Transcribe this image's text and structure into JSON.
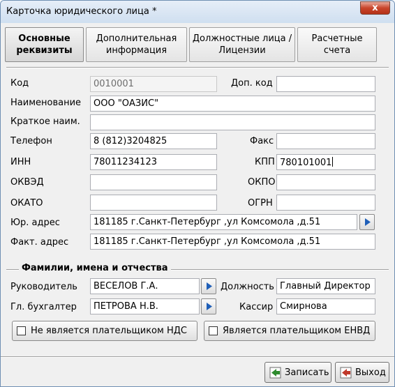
{
  "window": {
    "title": "Карточка юридического лица *",
    "close_glyph": "x"
  },
  "tabs": [
    {
      "label": "Основные\nреквизиты",
      "active": true
    },
    {
      "label": "Дополнительная\nинформация",
      "active": false
    },
    {
      "label": "Должностные лица /\nЛицензии",
      "active": false
    },
    {
      "label": "Расчетные\nсчета",
      "active": false
    }
  ],
  "fields": {
    "kod": {
      "label": "Код",
      "value": "0010001"
    },
    "dop_kod": {
      "label": "Доп. код",
      "value": ""
    },
    "naimenovanie": {
      "label": "Наименование",
      "value": "ООО \"ОАЗИС\""
    },
    "kratkoe": {
      "label": "Краткое наим.",
      "value": ""
    },
    "telefon": {
      "label": "Телефон",
      "value": "8 (812)3204825"
    },
    "faks": {
      "label": "Факс",
      "value": ""
    },
    "inn": {
      "label": "ИНН",
      "value": "78011234123"
    },
    "kpp": {
      "label": "КПП",
      "value": "780101001"
    },
    "okved": {
      "label": "ОКВЭД",
      "value": ""
    },
    "okpo": {
      "label": "ОКПО",
      "value": ""
    },
    "okato": {
      "label": "ОКАТО",
      "value": ""
    },
    "ogrn": {
      "label": "ОГРН",
      "value": ""
    },
    "yur_adres": {
      "label": "Юр. адрес",
      "value": "181185 г.Санкт-Петербург ,ул Комсомола ,д.51"
    },
    "fakt_adres": {
      "label": "Факт. адрес",
      "value": "181185 г.Санкт-Петербург ,ул Комсомола ,д.51"
    }
  },
  "persons": {
    "group_title": "Фамилии,  имена и отчества",
    "rukovoditel": {
      "label": "Руководитель",
      "value": "ВЕСЕЛОВ Г.А."
    },
    "dolzhnost": {
      "label": "Должность",
      "value": "Главный Директор"
    },
    "buhgalter": {
      "label": "Гл. бухгалтер",
      "value": "ПЕТРОВА Н.В."
    },
    "kassir": {
      "label": "Кассир",
      "value": "Смирнова"
    }
  },
  "checkboxes": {
    "nds": {
      "label": "Не является плательщиком НДС",
      "checked": false
    },
    "envd": {
      "label": "Является плательщиком ЕНВД",
      "checked": false
    }
  },
  "actions": {
    "save": "Записать",
    "exit": "Выход"
  },
  "colors": {
    "title_bar": "#dfe9f5",
    "close_button": "#c8452b",
    "select_arrow": "#1f5fb8",
    "save_icon": "#2e8b2e",
    "exit_icon": "#c0392b"
  }
}
